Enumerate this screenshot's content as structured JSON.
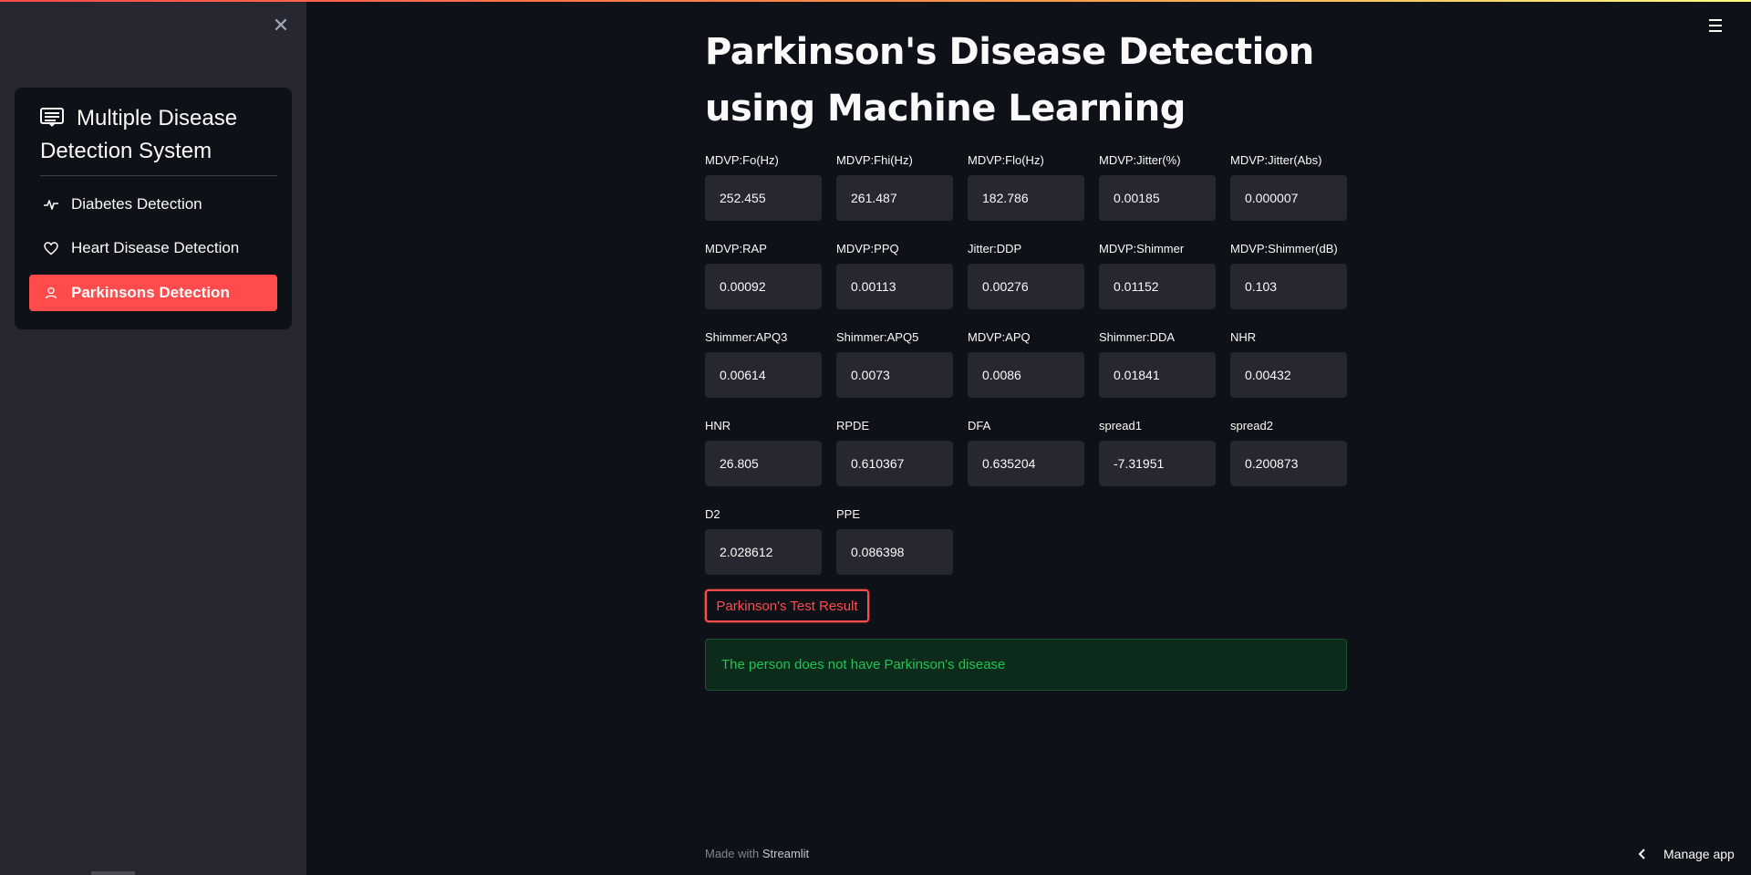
{
  "app": {
    "accent_color": "#ff4b4b",
    "background_color": "#0e1117",
    "sidebar_color": "#262730"
  },
  "sidebar": {
    "close_icon": "close-icon",
    "menu_title": "Multiple Disease Detection System",
    "menu_title_icon": "list-icon",
    "items": [
      {
        "label": "Diabetes Detection",
        "icon": "activity-icon",
        "active": false
      },
      {
        "label": "Heart Disease Detection",
        "icon": "heart-icon",
        "active": false
      },
      {
        "label": "Parkinsons Detection",
        "icon": "person-icon",
        "active": true
      }
    ]
  },
  "main": {
    "title": "Parkinson's Disease Detection using Machine Learning",
    "fields": [
      {
        "label": "MDVP:Fo(Hz)",
        "value": "252.455"
      },
      {
        "label": "MDVP:Fhi(Hz)",
        "value": "261.487"
      },
      {
        "label": "MDVP:Flo(Hz)",
        "value": "182.786"
      },
      {
        "label": "MDVP:Jitter(%)",
        "value": "0.00185"
      },
      {
        "label": "MDVP:Jitter(Abs)",
        "value": "0.000007"
      },
      {
        "label": "MDVP:RAP",
        "value": "0.00092"
      },
      {
        "label": "MDVP:PPQ",
        "value": "0.00113"
      },
      {
        "label": "Jitter:DDP",
        "value": "0.00276"
      },
      {
        "label": "MDVP:Shimmer",
        "value": "0.01152"
      },
      {
        "label": "MDVP:Shimmer(dB)",
        "value": "0.103"
      },
      {
        "label": "Shimmer:APQ3",
        "value": "0.00614"
      },
      {
        "label": "Shimmer:APQ5",
        "value": "0.0073"
      },
      {
        "label": "MDVP:APQ",
        "value": "0.0086"
      },
      {
        "label": "Shimmer:DDA",
        "value": "0.01841"
      },
      {
        "label": "NHR",
        "value": "0.00432"
      },
      {
        "label": "HNR",
        "value": "26.805"
      },
      {
        "label": "RPDE",
        "value": "0.610367"
      },
      {
        "label": "DFA",
        "value": "0.635204"
      },
      {
        "label": "spread1",
        "value": "-7.31951"
      },
      {
        "label": "spread2",
        "value": "0.200873"
      },
      {
        "label": "D2",
        "value": "2.028612"
      },
      {
        "label": "PPE",
        "value": "0.086398"
      }
    ],
    "test_button_label": "Parkinson's Test Result",
    "result_message": "The person does not have Parkinson's disease",
    "result_color": "#21c354"
  },
  "footer": {
    "made_with": "Made with",
    "brand": "Streamlit"
  },
  "manage_app": {
    "label": "Manage app",
    "icon": "chevron-left-icon"
  },
  "header": {
    "menu_icon": "hamburger-icon"
  }
}
